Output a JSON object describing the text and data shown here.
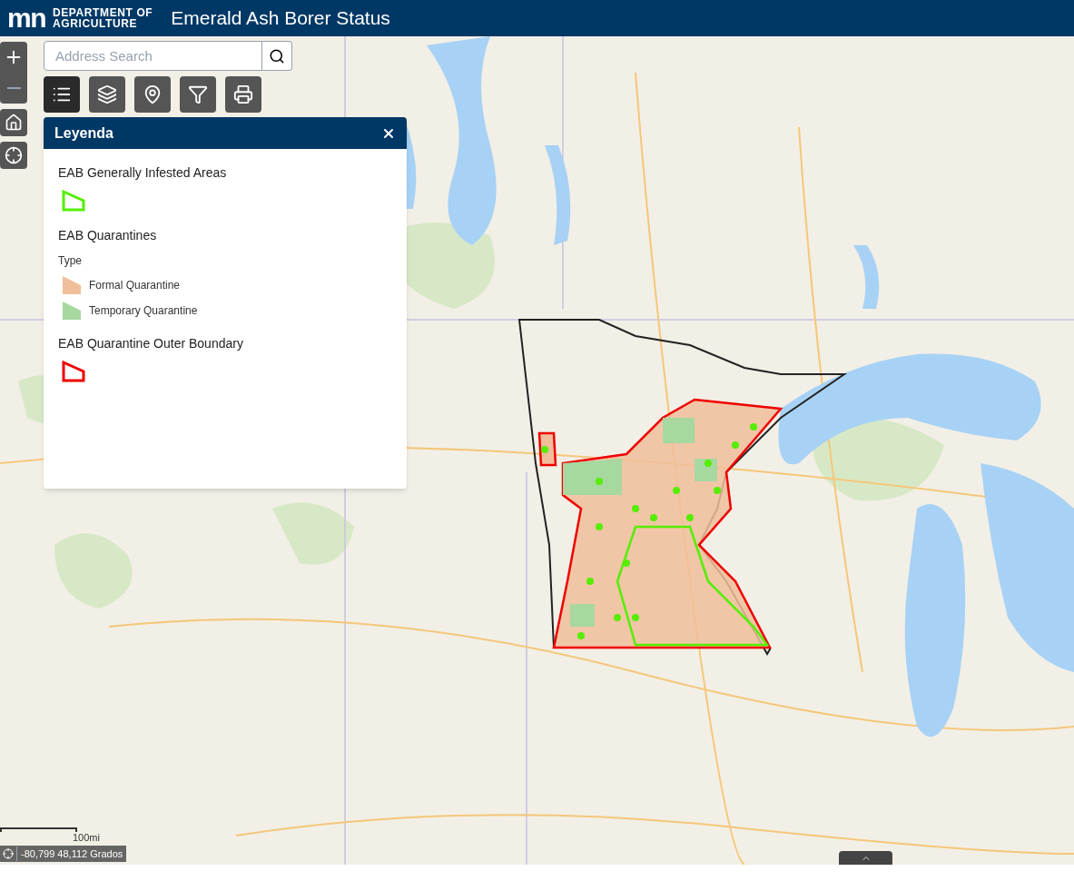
{
  "header": {
    "logo_mark": "mn",
    "logo_line_1": "DEPARTMENT OF",
    "logo_line_2": "AGRICULTURE",
    "title": "Emerald Ash Borer Status"
  },
  "search": {
    "placeholder": "Address Search"
  },
  "zoom": {
    "in_disabled": false,
    "out_disabled": true
  },
  "toolbar": [
    {
      "kind": "legend",
      "selected": true
    },
    {
      "kind": "layers",
      "selected": false
    },
    {
      "kind": "locate",
      "selected": false
    },
    {
      "kind": "filter",
      "selected": false
    },
    {
      "kind": "print",
      "selected": false
    }
  ],
  "legend": {
    "title": "Leyenda",
    "layers": [
      {
        "title": "EAB Generally Infested Areas",
        "symbols": [
          {
            "kind": "outline",
            "color": "#55ee00"
          }
        ]
      },
      {
        "title": "EAB Quarantines",
        "subtitle": "Type",
        "symbols": [
          {
            "kind": "fill",
            "color": "#f0be9a",
            "label": "Formal Quarantine"
          },
          {
            "kind": "fill",
            "color": "#a6d8a0",
            "label": "Temporary Quarantine"
          }
        ]
      },
      {
        "title": "EAB Quarantine Outer Boundary",
        "symbols": [
          {
            "kind": "outline",
            "color": "#ee0000"
          }
        ]
      }
    ]
  },
  "scale": {
    "label": "100mi"
  },
  "coordinates": {
    "text": "-80,799 48,112 Grados"
  }
}
